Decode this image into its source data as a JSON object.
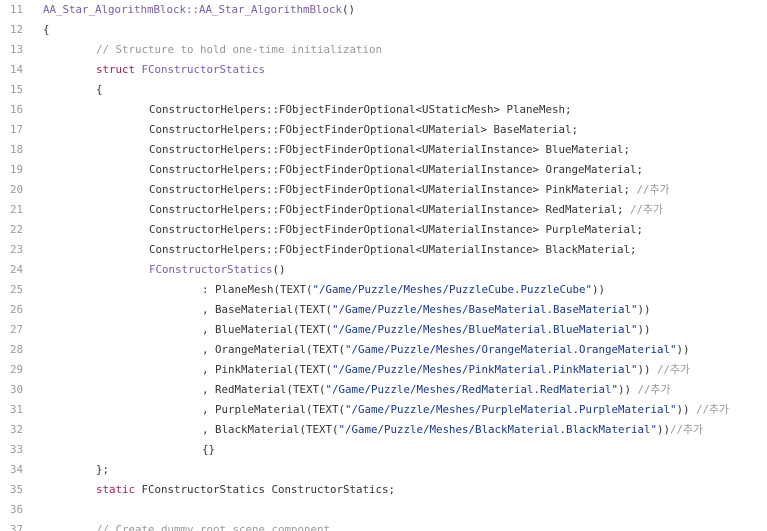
{
  "colors": {
    "background": "#ffffff",
    "line_number": "#999999",
    "plain": "#333333",
    "function": "#795da3",
    "keyword": "#a71d5d",
    "comment": "#969896",
    "string": "#183691"
  },
  "lines": [
    {
      "n": "11",
      "indent": 0,
      "tokens": [
        {
          "t": "fn",
          "v": "AA_Star_AlgorithmBlock::AA_Star_AlgorithmBlock"
        },
        {
          "t": "pl",
          "v": "()"
        }
      ]
    },
    {
      "n": "12",
      "indent": 0,
      "tokens": [
        {
          "t": "pl",
          "v": "{"
        }
      ]
    },
    {
      "n": "13",
      "indent": 1,
      "tokens": [
        {
          "t": "cm",
          "v": "// Structure to hold one-time initialization"
        }
      ]
    },
    {
      "n": "14",
      "indent": 1,
      "tokens": [
        {
          "t": "kw",
          "v": "struct"
        },
        {
          "t": "pl",
          "v": " "
        },
        {
          "t": "fn",
          "v": "FConstructorStatics"
        }
      ]
    },
    {
      "n": "15",
      "indent": 1,
      "tokens": [
        {
          "t": "pl",
          "v": "{"
        }
      ]
    },
    {
      "n": "16",
      "indent": 2,
      "tokens": [
        {
          "t": "pl",
          "v": "ConstructorHelpers::FObjectFinderOptional<UStaticMesh> PlaneMesh;"
        }
      ]
    },
    {
      "n": "17",
      "indent": 2,
      "tokens": [
        {
          "t": "pl",
          "v": "ConstructorHelpers::FObjectFinderOptional<UMaterial> BaseMaterial;"
        }
      ]
    },
    {
      "n": "18",
      "indent": 2,
      "tokens": [
        {
          "t": "pl",
          "v": "ConstructorHelpers::FObjectFinderOptional<UMaterialInstance> BlueMaterial;"
        }
      ]
    },
    {
      "n": "19",
      "indent": 2,
      "tokens": [
        {
          "t": "pl",
          "v": "ConstructorHelpers::FObjectFinderOptional<UMaterialInstance> OrangeMaterial;"
        }
      ]
    },
    {
      "n": "20",
      "indent": 2,
      "tokens": [
        {
          "t": "pl",
          "v": "ConstructorHelpers::FObjectFinderOptional<UMaterialInstance> PinkMaterial; "
        },
        {
          "t": "cm",
          "v": "//추가"
        }
      ]
    },
    {
      "n": "21",
      "indent": 2,
      "tokens": [
        {
          "t": "pl",
          "v": "ConstructorHelpers::FObjectFinderOptional<UMaterialInstance> RedMaterial; "
        },
        {
          "t": "cm",
          "v": "//추가"
        }
      ]
    },
    {
      "n": "22",
      "indent": 2,
      "tokens": [
        {
          "t": "pl",
          "v": "ConstructorHelpers::FObjectFinderOptional<UMaterialInstance> PurpleMaterial;"
        }
      ]
    },
    {
      "n": "23",
      "indent": 2,
      "tokens": [
        {
          "t": "pl",
          "v": "ConstructorHelpers::FObjectFinderOptional<UMaterialInstance> BlackMaterial;"
        }
      ]
    },
    {
      "n": "24",
      "indent": 2,
      "tokens": [
        {
          "t": "fn",
          "v": "FConstructorStatics"
        },
        {
          "t": "pl",
          "v": "()"
        }
      ]
    },
    {
      "n": "25",
      "indent": 3,
      "tokens": [
        {
          "t": "pl",
          "v": ": PlaneMesh(TEXT("
        },
        {
          "t": "st",
          "v": "\"/Game/Puzzle/Meshes/PuzzleCube.PuzzleCube\""
        },
        {
          "t": "pl",
          "v": "))"
        }
      ]
    },
    {
      "n": "26",
      "indent": 3,
      "tokens": [
        {
          "t": "pl",
          "v": ", BaseMaterial(TEXT("
        },
        {
          "t": "st",
          "v": "\"/Game/Puzzle/Meshes/BaseMaterial.BaseMaterial\""
        },
        {
          "t": "pl",
          "v": "))"
        }
      ]
    },
    {
      "n": "27",
      "indent": 3,
      "tokens": [
        {
          "t": "pl",
          "v": ", BlueMaterial(TEXT("
        },
        {
          "t": "st",
          "v": "\"/Game/Puzzle/Meshes/BlueMaterial.BlueMaterial\""
        },
        {
          "t": "pl",
          "v": "))"
        }
      ]
    },
    {
      "n": "28",
      "indent": 3,
      "tokens": [
        {
          "t": "pl",
          "v": ", OrangeMaterial(TEXT("
        },
        {
          "t": "st",
          "v": "\"/Game/Puzzle/Meshes/OrangeMaterial.OrangeMaterial\""
        },
        {
          "t": "pl",
          "v": "))"
        }
      ]
    },
    {
      "n": "29",
      "indent": 3,
      "tokens": [
        {
          "t": "pl",
          "v": ", PinkMaterial(TEXT("
        },
        {
          "t": "st",
          "v": "\"/Game/Puzzle/Meshes/PinkMaterial.PinkMaterial\""
        },
        {
          "t": "pl",
          "v": ")) "
        },
        {
          "t": "cm",
          "v": "//추가"
        }
      ]
    },
    {
      "n": "30",
      "indent": 3,
      "tokens": [
        {
          "t": "pl",
          "v": ", RedMaterial(TEXT("
        },
        {
          "t": "st",
          "v": "\"/Game/Puzzle/Meshes/RedMaterial.RedMaterial\""
        },
        {
          "t": "pl",
          "v": ")) "
        },
        {
          "t": "cm",
          "v": "//추가"
        }
      ]
    },
    {
      "n": "31",
      "indent": 3,
      "tokens": [
        {
          "t": "pl",
          "v": ", PurpleMaterial(TEXT("
        },
        {
          "t": "st",
          "v": "\"/Game/Puzzle/Meshes/PurpleMaterial.PurpleMaterial\""
        },
        {
          "t": "pl",
          "v": ")) "
        },
        {
          "t": "cm",
          "v": "//추가"
        }
      ]
    },
    {
      "n": "32",
      "indent": 3,
      "tokens": [
        {
          "t": "pl",
          "v": ", BlackMaterial(TEXT("
        },
        {
          "t": "st",
          "v": "\"/Game/Puzzle/Meshes/BlackMaterial.BlackMaterial\""
        },
        {
          "t": "pl",
          "v": "))"
        },
        {
          "t": "cm",
          "v": "//추가"
        }
      ]
    },
    {
      "n": "33",
      "indent": 3,
      "tokens": [
        {
          "t": "pl",
          "v": "{}"
        }
      ]
    },
    {
      "n": "34",
      "indent": 1,
      "tokens": [
        {
          "t": "pl",
          "v": "};"
        }
      ]
    },
    {
      "n": "35",
      "indent": 1,
      "tokens": [
        {
          "t": "kw",
          "v": "static"
        },
        {
          "t": "pl",
          "v": " FConstructorStatics ConstructorStatics;"
        }
      ]
    },
    {
      "n": "36",
      "indent": 0,
      "tokens": []
    },
    {
      "n": "37",
      "indent": 1,
      "tokens": [
        {
          "t": "cm",
          "v": "// Create dummy root scene component"
        }
      ]
    }
  ]
}
